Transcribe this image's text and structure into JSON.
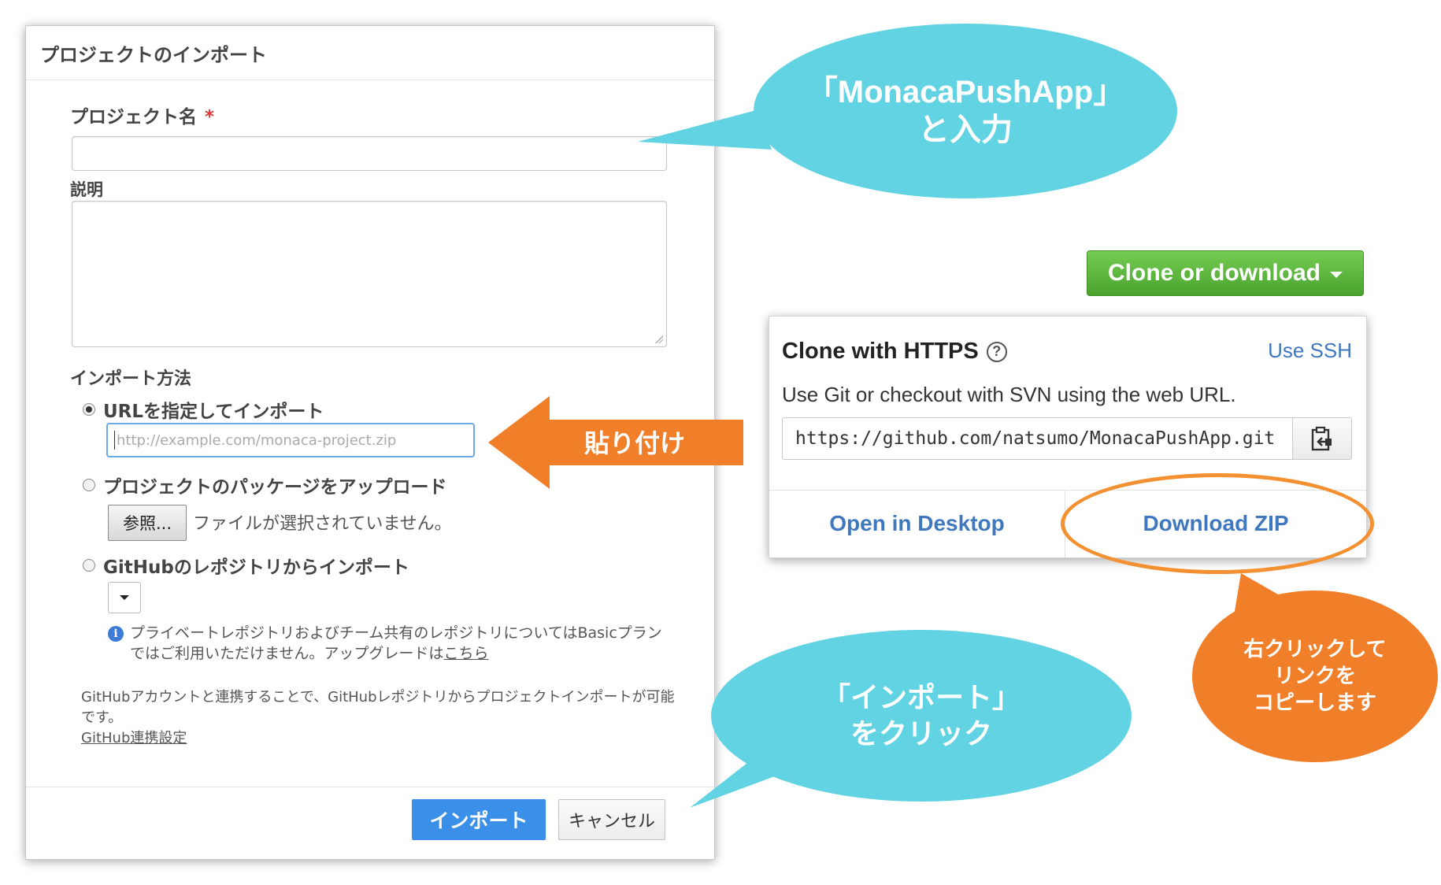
{
  "dialog": {
    "title": "プロジェクトのインポート",
    "project_name_label": "プロジェクト名",
    "required_mark": "*",
    "description_label": "説明",
    "import_method_label": "インポート方法",
    "option_url_label": "URLを指定してインポート",
    "url_placeholder": "http://example.com/monaca-project.zip",
    "option_upload_label": "プロジェクトのパッケージをアップロード",
    "browse_button": "参照...",
    "file_status": "ファイルが選択されていません。",
    "option_github_label": "GitHubのレポジトリからインポート",
    "info_text": "プライベートレポジトリおよびチーム共有のレポジトリについてはBasicプランではご利用いただけません。アップグレードは",
    "info_link": "こちら",
    "note_text": "GitHubアカウントと連携することで、GitHubレポジトリからプロジェクトインポートが可能です。",
    "note_link": "GitHub連携設定",
    "import_button": "インポート",
    "cancel_button": "キャンセル"
  },
  "callouts": {
    "project_name_line1": "「MonacaPushApp」",
    "project_name_line2": "と入力",
    "paste_label": "貼り付け",
    "import_click_line1": "「インポート」",
    "import_click_line2": "をクリック",
    "copy_line1": "右クリックして",
    "copy_line2": "リンクを",
    "copy_line3": "コピーします"
  },
  "github": {
    "clone_button": "Clone or download",
    "panel_title": "Clone with HTTPS",
    "help_symbol": "?",
    "use_ssh": "Use SSH",
    "description": "Use Git or checkout with SVN using the web URL.",
    "url": "https://github.com/natsumo/MonacaPushApp.git",
    "open_desktop": "Open in Desktop",
    "download_zip": "Download ZIP"
  },
  "colors": {
    "callout_cyan": "#62d3e3",
    "callout_orange": "#f17f2a",
    "github_green": "#55b13a",
    "github_link": "#4078c0",
    "import_blue": "#3a8fe8"
  }
}
